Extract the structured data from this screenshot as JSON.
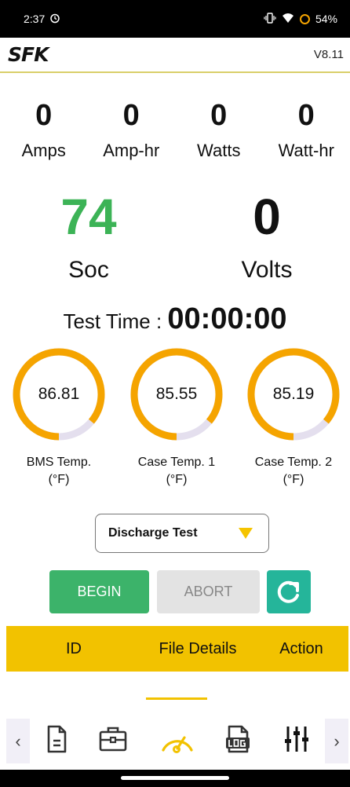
{
  "status_bar": {
    "time": "2:37",
    "battery": "54%",
    "colors": {
      "battery_ring": "#f5a400"
    }
  },
  "app_bar": {
    "logo_text": "SFK",
    "version": "V8.11"
  },
  "metrics": [
    {
      "value": "0",
      "label": "Amps"
    },
    {
      "value": "0",
      "label": "Amp-hr"
    },
    {
      "value": "0",
      "label": "Watts"
    },
    {
      "value": "0",
      "label": "Watt-hr"
    }
  ],
  "soc": {
    "value": "74",
    "label": "Soc",
    "color": "#3cb356"
  },
  "volts": {
    "value": "0",
    "label": "Volts"
  },
  "test_time": {
    "label": "Test Time :",
    "value": "00:00:00"
  },
  "gauges": [
    {
      "value": "86.81",
      "label_line1": "BMS Temp.",
      "label_line2": "(°F)",
      "fraction": 0.86
    },
    {
      "value": "85.55",
      "label_line1": "Case Temp. 1",
      "label_line2": "(°F)",
      "fraction": 0.86
    },
    {
      "value": "85.19",
      "label_line1": "Case Temp. 2",
      "label_line2": "(°F)",
      "fraction": 0.86
    }
  ],
  "test_select": {
    "selected": "Discharge Test"
  },
  "buttons": {
    "begin": "BEGIN",
    "abort": "ABORT"
  },
  "table": {
    "headers": [
      "ID",
      "File Details",
      "Action"
    ]
  },
  "nav": {
    "items": [
      "document-icon",
      "toolbox-icon",
      "gauge-icon",
      "log-file-icon",
      "sliders-icon"
    ],
    "active": "gauge-icon",
    "left_arrow": "‹",
    "right_arrow": "›"
  },
  "colors": {
    "accent_yellow": "#f2c200",
    "gauge_orange": "#f5a400",
    "gauge_track": "#e4dfee",
    "begin_green": "#3cb36a",
    "refresh_teal": "#25b59a"
  }
}
